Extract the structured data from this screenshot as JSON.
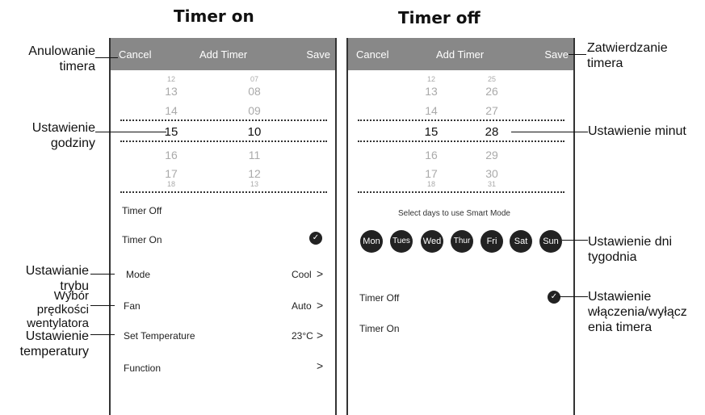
{
  "left": {
    "title": "Timer on",
    "bar": {
      "cancel": "Cancel",
      "title": "Add Timer",
      "save": "Save"
    },
    "hours": [
      "12",
      "13",
      "14",
      "15",
      "16",
      "17",
      "18"
    ],
    "minutes": [
      "07",
      "08",
      "09",
      "10",
      "11",
      "12",
      "13"
    ],
    "rows": {
      "timer_off": "Timer Off",
      "timer_on": "Timer On",
      "mode": "Mode",
      "mode_val": "Cool",
      "fan": "Fan",
      "fan_val": "Auto",
      "temp": "Set Temperature",
      "temp_val": "23°C",
      "function": "Function"
    }
  },
  "right": {
    "title": "Timer off",
    "bar": {
      "cancel": "Cancel",
      "title": "Add Timer",
      "save": "Save"
    },
    "hours": [
      "12",
      "13",
      "14",
      "15",
      "16",
      "17",
      "18"
    ],
    "minutes": [
      "25",
      "26",
      "27",
      "28",
      "29",
      "30",
      "31"
    ],
    "days_caption": "Select days to use Smart Mode",
    "days": [
      "Mon",
      "Tues",
      "Wed",
      "Thur",
      "Fri",
      "Sat",
      "Sun"
    ],
    "rows": {
      "timer_off": "Timer Off",
      "timer_on": "Timer On"
    }
  },
  "annotations": {
    "cancel": "Anulowanie\ntimera",
    "hour": "Ustawienie\ngodziny",
    "mode": "Ustawianie\ntrybu",
    "fan": "Wybór\nprędkości\nwentylatora",
    "temp": "Ustawienie\ntemperatury",
    "save": "Zatwierdzanie\ntimera",
    "minute": "Ustawienie minut",
    "days": "Ustawienie dni\ntygodnia",
    "onoff": "Ustawienie\nwłączenia/wyłącz\nenia timera"
  },
  "icons": {
    "check": "check-icon",
    "chevron": "chevron-right-icon"
  },
  "colors": {
    "bar": "#888888",
    "day_circle": "#222222"
  }
}
